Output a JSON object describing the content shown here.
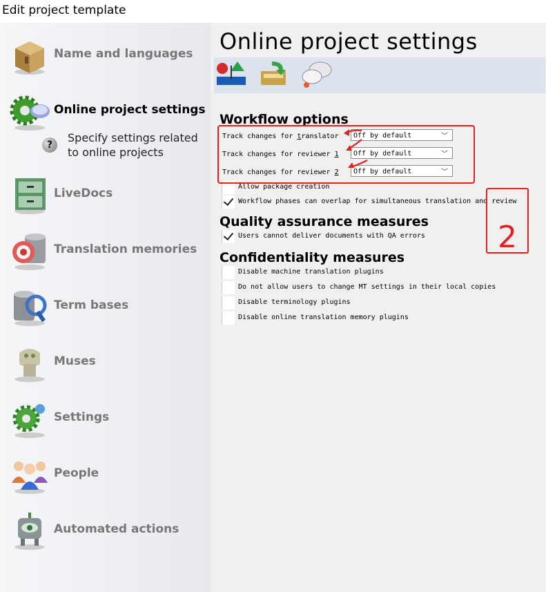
{
  "window": {
    "title": "Edit project template"
  },
  "sidebar": {
    "items": [
      {
        "label": "Name and languages",
        "icon": "box-icon",
        "active": false
      },
      {
        "label": "Online project settings",
        "icon": "server-gear-icon",
        "active": true,
        "description": "Specify settings related to online projects"
      },
      {
        "label": "LiveDocs",
        "icon": "cabinet-icon",
        "active": false
      },
      {
        "label": "Translation memories",
        "icon": "database-icon",
        "active": false
      },
      {
        "label": "Term bases",
        "icon": "termbase-icon",
        "active": false
      },
      {
        "label": "Muses",
        "icon": "muse-icon",
        "active": false
      },
      {
        "label": "Settings",
        "icon": "gear-icon",
        "active": false
      },
      {
        "label": "People",
        "icon": "people-icon",
        "active": false
      },
      {
        "label": "Automated actions",
        "icon": "robot-icon",
        "active": false
      }
    ]
  },
  "main": {
    "title": "Online project settings",
    "toolbar": [
      {
        "icon": "workflow-icon"
      },
      {
        "icon": "drawer-icon"
      },
      {
        "icon": "chat-icon"
      }
    ],
    "workflow": {
      "title": "Workflow options",
      "dropdown_rows": [
        {
          "label_pre": "Track changes for ",
          "label_accel": "t",
          "label_post": "ranslator",
          "value": "Off by default"
        },
        {
          "label_pre": "Track changes for reviewer ",
          "label_accel": "1",
          "label_post": "",
          "value": "Off by default"
        },
        {
          "label_pre": "Track changes for reviewer ",
          "label_accel": "2",
          "label_post": "",
          "value": "Off by default"
        }
      ],
      "checkboxes": [
        {
          "label": "Allow package creation",
          "checked": false
        },
        {
          "label": "Workflow phases can overlap for simultaneous translation and review",
          "checked": true
        }
      ]
    },
    "qa": {
      "title": "Quality assurance measures",
      "checkboxes": [
        {
          "label": "Users cannot deliver documents with QA errors",
          "checked": true
        }
      ]
    },
    "confidentiality": {
      "title": "Confidentiality measures",
      "checkboxes": [
        {
          "label": "Disable machine translation plugins",
          "checked": false
        },
        {
          "label": "Do not allow users to change MT settings in their local copies",
          "checked": false
        },
        {
          "label": "Disable terminology plugins",
          "checked": false
        },
        {
          "label": "Disable online translation memory plugins",
          "checked": false
        }
      ]
    }
  },
  "annotation": {
    "number": "2",
    "color": "#e52020"
  }
}
